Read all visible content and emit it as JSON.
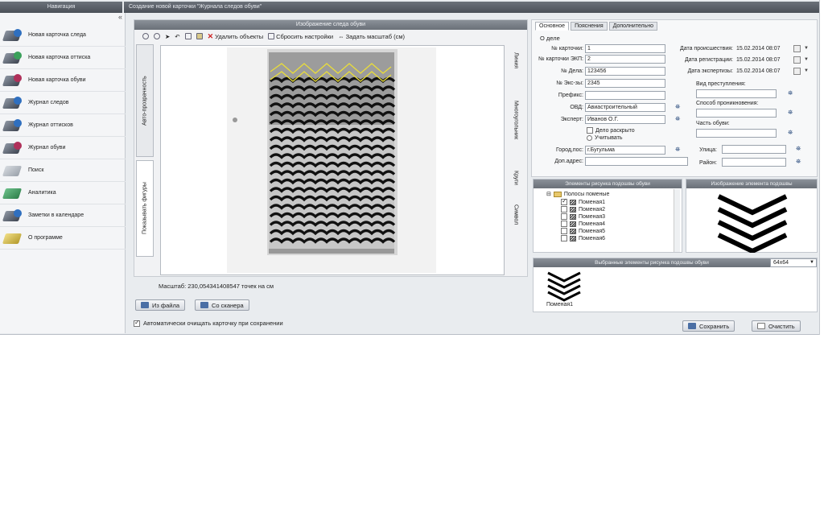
{
  "nav_header": "Навигация",
  "main_header": "Создание новой карточки \"Журнала следов обуви\"",
  "sidebar": {
    "collapse": "«",
    "items": [
      {
        "label": "Новая карточка следа",
        "icon": "new-trace-card-icon",
        "accent": "#2f6fbf"
      },
      {
        "label": "Новая карточка оттиска",
        "icon": "new-impression-card-icon",
        "accent": "#3aa05a"
      },
      {
        "label": "Новая карточка обуви",
        "icon": "new-shoe-card-icon",
        "accent": "#b0305a"
      },
      {
        "label": "Журнал следов",
        "icon": "traces-journal-icon",
        "accent": "#2f6fbf"
      },
      {
        "label": "Журнал оттисков",
        "icon": "impressions-journal-icon",
        "accent": "#2f6fbf"
      },
      {
        "label": "Журнал обуви",
        "icon": "shoes-journal-icon",
        "accent": "#b0305a"
      },
      {
        "label": "Поиск",
        "icon": "search-icon",
        "accent": "#c0c4ca"
      },
      {
        "label": "Аналитика",
        "icon": "analytics-icon",
        "accent": "#3aa05a"
      },
      {
        "label": "Заметки в календаре",
        "icon": "calendar-notes-icon",
        "accent": "#2f6fbf"
      },
      {
        "label": "О программе",
        "icon": "about-icon",
        "accent": "#e0c040"
      }
    ]
  },
  "image_panel": {
    "title": "Изображение следа обуви",
    "toolbar": {
      "delete_objects": "Удалить объекты",
      "reset_settings": "Сбросить настройки",
      "set_scale": "Задать масштаб (см)"
    },
    "left_tabs": [
      "Авто-прозрачность",
      "Показывать фигуры"
    ],
    "right_tabs": [
      "Линия",
      "Многоугольник",
      "Круги",
      "Символ"
    ],
    "scale_text": "Масштаб: 230,054341408547 точек на см",
    "from_file": "Из файла",
    "from_scanner": "Со сканера",
    "auto_clear": "Автоматически очищать карточку при сохранении"
  },
  "form": {
    "tabs": [
      "Основное",
      "Пояснения",
      "Дополнительно"
    ],
    "section": "О деле",
    "card_no_label": "№ карточки:",
    "card_no": "1",
    "ekp_label": "№ карточки ЭКП:",
    "ekp": "2",
    "case_label": "№ Дела:",
    "case": "123456",
    "exam_label": "№ Экс-зы:",
    "exam": "2345",
    "prefix_label": "Префикс:",
    "prefix": "",
    "ovd_label": "ОВД:",
    "ovd": "Авиастроительный",
    "expert_label": "Эксперт:",
    "expert": "Иванов О.Г.",
    "case_solved": "Дело раскрыто",
    "consider": "Учитывать",
    "city_label": "Город,пос:",
    "city": "г.Бугульма",
    "extra_label": "Доп.адрес:",
    "extra": "",
    "incident_date_label": "Дата происшествия:",
    "incident_date": "15.02.2014 08:07",
    "reg_date_label": "Дата регистрации:",
    "reg_date": "15.02.2014 08:07",
    "exam_date_label": "Дата экспертизы:",
    "exam_date": "15.02.2014 08:07",
    "crime_type_label": "Вид преступления:",
    "entry_label": "Способ проникновения:",
    "shoe_part_label": "Часть обуви:",
    "street_label": "Улица:",
    "district_label": "Район:"
  },
  "tree": {
    "title": "Элементы рисунка подошвы обуви",
    "root": "Полосы поменые",
    "items": [
      "Поменая1",
      "Поменая2",
      "Поменая3",
      "Поменая4",
      "Поменая5",
      "Поменая6"
    ]
  },
  "preview": {
    "title": "Изображение элемента подошвы"
  },
  "selected": {
    "title": "Выбранные элементы рисунка подошвы обуви",
    "size": "64x64",
    "item_label": "Поменая1"
  },
  "buttons": {
    "save": "Сохранить",
    "clear": "Очистить"
  }
}
